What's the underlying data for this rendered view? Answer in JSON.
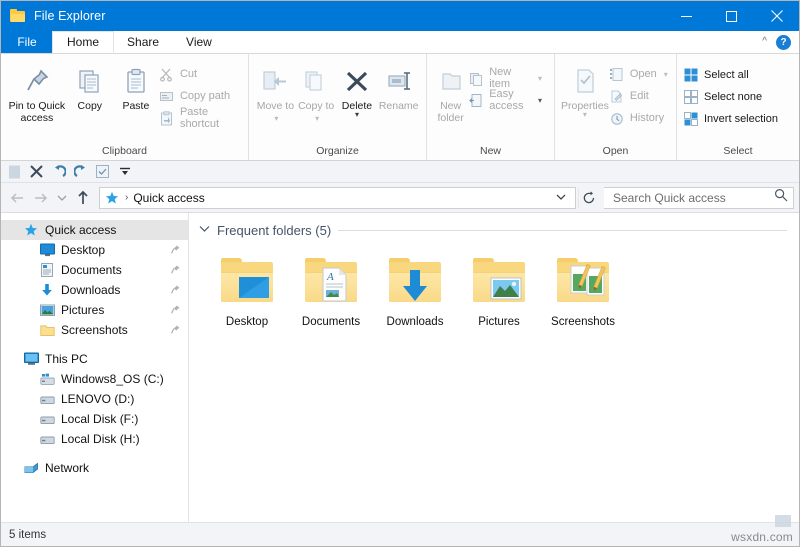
{
  "window": {
    "title": "File Explorer",
    "icon": "folder-icon",
    "minimize_label": "Minimize",
    "maximize_label": "Maximize",
    "close_label": "Close"
  },
  "menubar": {
    "file_label": "File",
    "tabs": [
      {
        "label": "Home",
        "active": true
      },
      {
        "label": "Share",
        "active": false
      },
      {
        "label": "View",
        "active": false
      }
    ],
    "collapse_icon": "chevron-up-icon",
    "help_label": "?"
  },
  "ribbon": {
    "groups": [
      {
        "name": "clipboard",
        "label": "Clipboard",
        "big_buttons": [
          {
            "label": "Pin to Quick access",
            "icon": "pin-icon",
            "disabled": false
          },
          {
            "label": "Copy",
            "icon": "copy-icon",
            "disabled": false
          },
          {
            "label": "Paste",
            "icon": "paste-icon",
            "disabled": false
          }
        ],
        "small_buttons": [
          {
            "label": "Cut",
            "icon": "scissors-icon",
            "disabled": true
          },
          {
            "label": "Copy path",
            "icon": "copy-path-icon",
            "disabled": true
          },
          {
            "label": "Paste shortcut",
            "icon": "paste-shortcut-icon",
            "disabled": true
          }
        ]
      },
      {
        "name": "organize",
        "label": "Organize",
        "big_buttons": [
          {
            "label": "Move to",
            "icon": "move-to-icon",
            "disabled": true,
            "dropdown": true
          },
          {
            "label": "Copy to",
            "icon": "copy-to-icon",
            "disabled": true,
            "dropdown": true
          },
          {
            "label": "Delete",
            "icon": "delete-x-icon",
            "disabled": false,
            "dropdown": true
          },
          {
            "label": "Rename",
            "icon": "rename-icon",
            "disabled": true
          }
        ]
      },
      {
        "name": "new",
        "label": "New",
        "big_buttons": [
          {
            "label": "New folder",
            "icon": "new-folder-icon",
            "disabled": true
          }
        ],
        "small_buttons": [
          {
            "label": "New item",
            "icon": "new-item-icon",
            "disabled": true,
            "dropdown": true
          },
          {
            "label": "Easy access",
            "icon": "easy-access-icon",
            "disabled": true,
            "dropdown": true
          }
        ]
      },
      {
        "name": "open",
        "label": "Open",
        "big_buttons": [
          {
            "label": "Properties",
            "icon": "properties-icon",
            "disabled": true,
            "dropdown": true
          }
        ],
        "small_buttons": [
          {
            "label": "Open",
            "icon": "open-icon",
            "disabled": true,
            "dropdown": true
          },
          {
            "label": "Edit",
            "icon": "edit-icon",
            "disabled": true
          },
          {
            "label": "History",
            "icon": "history-icon",
            "disabled": true
          }
        ]
      },
      {
        "name": "select",
        "label": "Select",
        "small_buttons": [
          {
            "label": "Select all",
            "icon": "select-all-icon",
            "disabled": false
          },
          {
            "label": "Select none",
            "icon": "select-none-icon",
            "disabled": false
          },
          {
            "label": "Invert selection",
            "icon": "invert-selection-icon",
            "disabled": false
          }
        ]
      }
    ]
  },
  "quick_access_toolbar": {
    "items": [
      {
        "name": "properties-qat",
        "icon": "document-icon"
      },
      {
        "name": "delete-qat",
        "icon": "x-icon"
      },
      {
        "name": "redo-qat",
        "icon": "redo-arrow-icon"
      },
      {
        "name": "undo-qat",
        "icon": "undo-arrow-icon"
      },
      {
        "name": "details-qat",
        "icon": "checkbox-icon"
      },
      {
        "name": "customize-qat",
        "icon": "chevron-down-bar-icon"
      }
    ]
  },
  "addressbar": {
    "back_icon": "arrow-left-icon",
    "forward_icon": "arrow-right-icon",
    "recent_icon": "chevron-down-icon",
    "up_icon": "arrow-up-icon",
    "breadcrumb_icon": "quick-access-star-icon",
    "breadcrumb_separator": "›",
    "breadcrumb": "Quick access",
    "dropdown_icon": "chevron-down-icon",
    "refresh_icon": "refresh-icon",
    "search_placeholder": "Search Quick access",
    "search_value": "",
    "search_icon": "search-icon"
  },
  "sidebar": {
    "items": [
      {
        "label": "Quick access",
        "icon": "quick-access-star-icon",
        "indent": 0,
        "selected": true,
        "pinned": false
      },
      {
        "label": "Desktop",
        "icon": "desktop-icon",
        "indent": 1,
        "selected": false,
        "pinned": true
      },
      {
        "label": "Documents",
        "icon": "documents-icon",
        "indent": 1,
        "selected": false,
        "pinned": true
      },
      {
        "label": "Downloads",
        "icon": "downloads-arrow-icon",
        "indent": 1,
        "selected": false,
        "pinned": true
      },
      {
        "label": "Pictures",
        "icon": "pictures-icon",
        "indent": 1,
        "selected": false,
        "pinned": true
      },
      {
        "label": "Screenshots",
        "icon": "folder-icon",
        "indent": 1,
        "selected": false,
        "pinned": true
      },
      {
        "label": "This PC",
        "icon": "this-pc-icon",
        "indent": 0,
        "selected": false,
        "pinned": false,
        "gap_before": true
      },
      {
        "label": "Windows8_OS (C:)",
        "icon": "windows-drive-icon",
        "indent": 1,
        "selected": false,
        "pinned": false
      },
      {
        "label": "LENOVO (D:)",
        "icon": "drive-icon",
        "indent": 1,
        "selected": false,
        "pinned": false
      },
      {
        "label": "Local Disk (F:)",
        "icon": "drive-icon",
        "indent": 1,
        "selected": false,
        "pinned": false
      },
      {
        "label": "Local Disk (H:)",
        "icon": "drive-icon",
        "indent": 1,
        "selected": false,
        "pinned": false
      },
      {
        "label": "Network",
        "icon": "network-icon",
        "indent": 0,
        "selected": false,
        "pinned": false,
        "gap_before": true
      }
    ]
  },
  "content": {
    "section": {
      "chevron": "⌄",
      "title": "Frequent folders (5)"
    },
    "tiles": [
      {
        "label": "Desktop",
        "icon": "desktop-folder-icon"
      },
      {
        "label": "Documents",
        "icon": "documents-folder-icon"
      },
      {
        "label": "Downloads",
        "icon": "downloads-folder-icon"
      },
      {
        "label": "Pictures",
        "icon": "pictures-folder-icon"
      },
      {
        "label": "Screenshots",
        "icon": "screenshots-folder-icon"
      }
    ]
  },
  "statusbar": {
    "item_count": "5 items"
  },
  "watermark": {
    "text": "wsxdn.com"
  },
  "colors": {
    "accent": "#0078d7",
    "titlebar": "#0078d7",
    "section_heading": "#44546a",
    "folder_yellow": "#f8d77e",
    "selection": "#e5e5e5"
  }
}
